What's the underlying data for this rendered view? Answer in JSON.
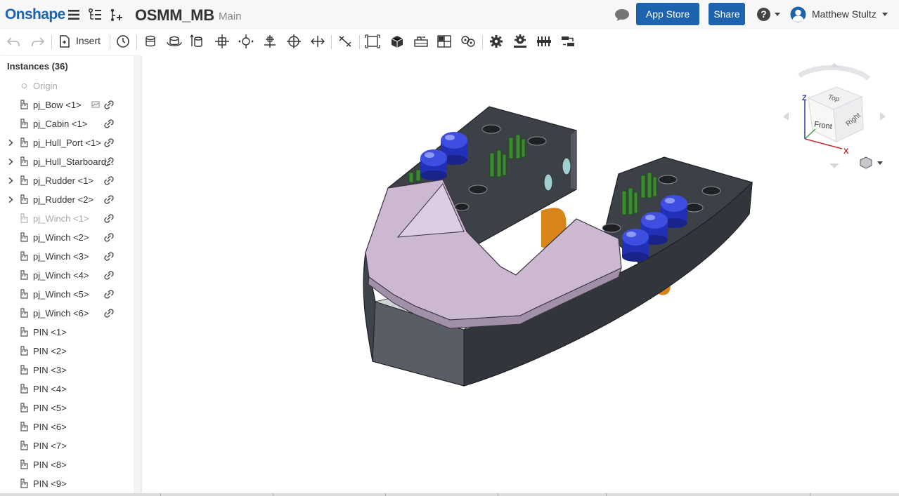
{
  "header": {
    "logo": "Onshape",
    "doc_title": "OSMM_MB",
    "doc_sub": "Main",
    "app_store": "App Store",
    "share": "Share",
    "help": "?",
    "user": "Matthew Stultz"
  },
  "toolbar": {
    "insert": "Insert"
  },
  "panel": {
    "title": "Instances (36)",
    "items": [
      {
        "label": "Origin",
        "kind": "origin"
      },
      {
        "label": "pj_Bow <1>",
        "kind": "part",
        "link": true,
        "sub": true
      },
      {
        "label": "pj_Cabin <1>",
        "kind": "part",
        "link": true
      },
      {
        "label": "pj_Hull_Port <1>",
        "kind": "part",
        "link": true,
        "expand": true
      },
      {
        "label": "pj_Hull_Starboard...",
        "kind": "part",
        "link": true,
        "expand": true
      },
      {
        "label": "pj_Rudder <1>",
        "kind": "part",
        "link": true,
        "expand": true
      },
      {
        "label": "pj_Rudder <2>",
        "kind": "part",
        "link": true,
        "expand": true
      },
      {
        "label": "pj_Winch <1>",
        "kind": "part",
        "link": true,
        "dim": true
      },
      {
        "label": "pj_Winch <2>",
        "kind": "part",
        "link": true
      },
      {
        "label": "pj_Winch <3>",
        "kind": "part",
        "link": true
      },
      {
        "label": "pj_Winch <4>",
        "kind": "part",
        "link": true
      },
      {
        "label": "pj_Winch <5>",
        "kind": "part",
        "link": true
      },
      {
        "label": "pj_Winch <6>",
        "kind": "part",
        "link": true
      },
      {
        "label": "PIN <1>",
        "kind": "part"
      },
      {
        "label": "PIN <2>",
        "kind": "part"
      },
      {
        "label": "PIN <3>",
        "kind": "part"
      },
      {
        "label": "PIN <4>",
        "kind": "part"
      },
      {
        "label": "PIN <5>",
        "kind": "part"
      },
      {
        "label": "PIN <6>",
        "kind": "part"
      },
      {
        "label": "PIN <7>",
        "kind": "part"
      },
      {
        "label": "PIN <8>",
        "kind": "part"
      },
      {
        "label": "PIN <9>",
        "kind": "part"
      }
    ]
  },
  "view_cube": {
    "top": "Top",
    "front": "Front",
    "right": "Right",
    "axis_x": "X",
    "axis_z": "Z"
  },
  "colors": {
    "brand": "#1d63ad",
    "hull": "#4a4e55",
    "bow": "#cdb8d2",
    "winch": "#2230b8",
    "pin": "#3c8a30",
    "rudder": "#d8861c"
  }
}
